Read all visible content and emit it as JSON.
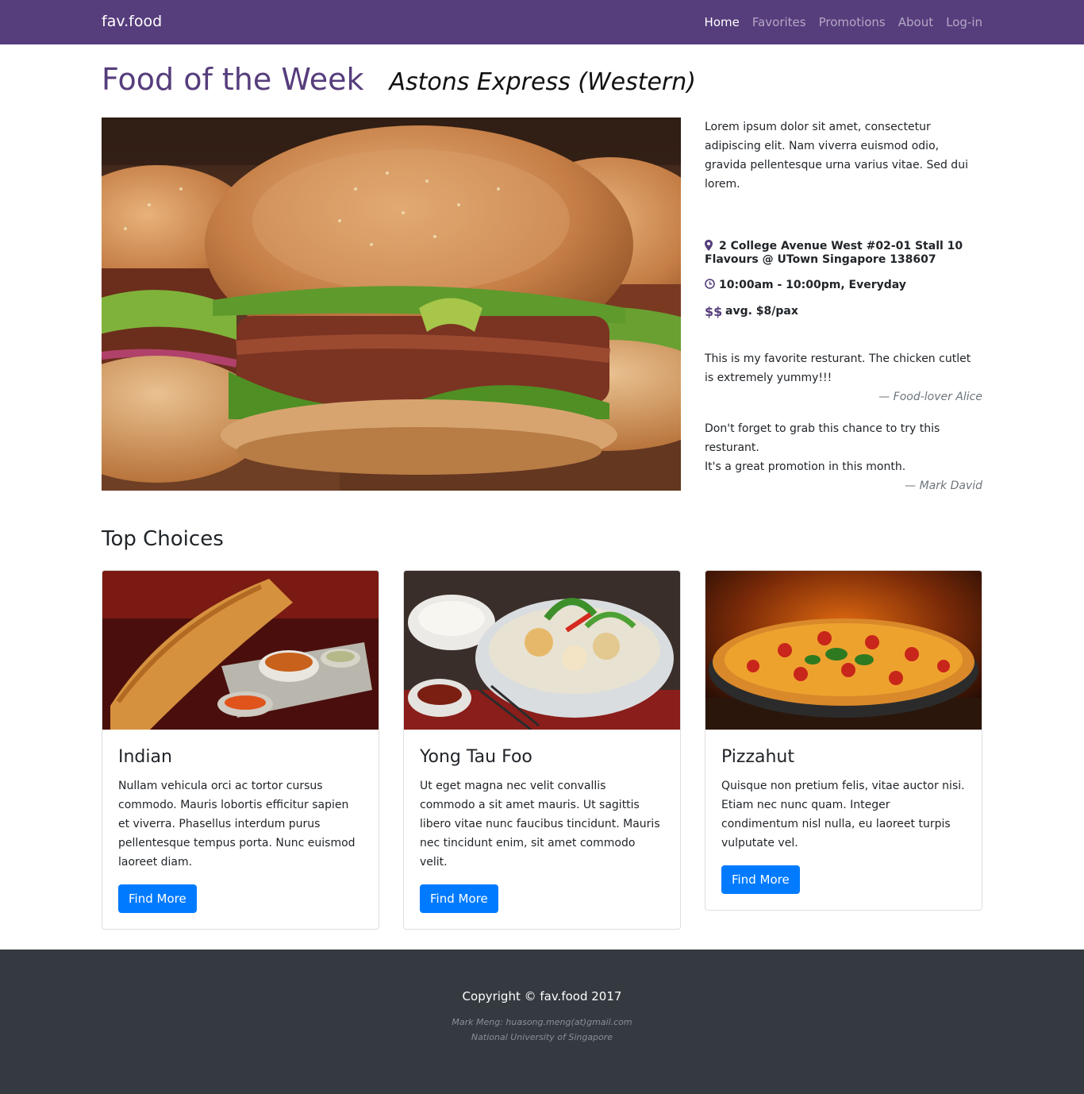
{
  "nav": {
    "brand": "fav.food",
    "items": [
      {
        "label": "Home",
        "active": true
      },
      {
        "label": "Favorites",
        "active": false
      },
      {
        "label": "Promotions",
        "active": false
      },
      {
        "label": "About",
        "active": false
      },
      {
        "label": "Log-in",
        "active": false
      }
    ]
  },
  "hero": {
    "title": "Food of the Week",
    "subtitle": "Astons Express (Western)",
    "image_icon": "burger-photo",
    "description": "Lorem ipsum dolor sit amet, consectetur adipiscing elit. Nam viverra euismod odio, gravida pellentesque urna varius vitae. Sed dui lorem.",
    "address_line1": "2 College Avenue West #02-01 Stall 10",
    "address_line2": "Flavours @ UTown Singapore 138607",
    "hours": "10:00am - 10:00pm, Everyday",
    "price_symbol": "$$",
    "price": "avg. $8/pax",
    "reviews": [
      {
        "lines": [
          "This is my favorite resturant. The chicken cutlet is extremely yummy!!!"
        ],
        "author": "— Food-lover Alice"
      },
      {
        "lines": [
          "Don't forget to grab this chance to try this resturant.",
          "It's a great promotion in this month."
        ],
        "author": "— Mark David"
      }
    ]
  },
  "top_choices": {
    "title": "Top Choices",
    "cards": [
      {
        "title": "Indian",
        "text": "Nullam vehicula orci ac tortor cursus commodo. Mauris lobortis efficitur sapien et viverra. Phasellus interdum purus pellentesque tempus porta. Nunc euismod laoreet diam.",
        "button": "Find More"
      },
      {
        "title": "Yong Tau Foo",
        "text": "Ut eget magna nec velit convallis commodo a sit amet mauris. Ut sagittis libero vitae nunc faucibus tincidunt. Mauris nec tincidunt enim, sit amet commodo velit.",
        "button": "Find More"
      },
      {
        "title": "Pizzahut",
        "text": "Quisque non pretium felis, vitae auctor nisi. Etiam nec nunc quam. Integer condimentum nisl nulla, eu laoreet turpis vulputate vel.",
        "button": "Find More"
      }
    ]
  },
  "footer": {
    "copyright": "Copyright © fav.food 2017",
    "author": "Mark Meng: huasong.meng(at)gmail.com",
    "org": "National University of Singapore"
  },
  "colors": {
    "brand": "#563d7c",
    "button": "#007bff",
    "footer": "#343a40"
  }
}
